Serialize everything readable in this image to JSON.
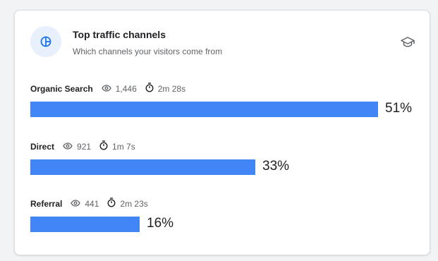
{
  "header": {
    "title": "Top traffic channels",
    "subtitle": "Which channels your visitors come from",
    "icon": "pie-chart-icon",
    "action_icon": "school-icon"
  },
  "colors": {
    "bar": "#4285f4",
    "icon_bg": "#e8f0fe",
    "icon_fg": "#1a73e8"
  },
  "channels": [
    {
      "name": "Organic Search",
      "views": "1,446",
      "duration": "2m 28s",
      "percent_label": "51%",
      "share": 0.51
    },
    {
      "name": "Direct",
      "views": "921",
      "duration": "1m 7s",
      "percent_label": "33%",
      "share": 0.33
    },
    {
      "name": "Referral",
      "views": "441",
      "duration": "2m 23s",
      "percent_label": "16%",
      "share": 0.16
    }
  ]
}
